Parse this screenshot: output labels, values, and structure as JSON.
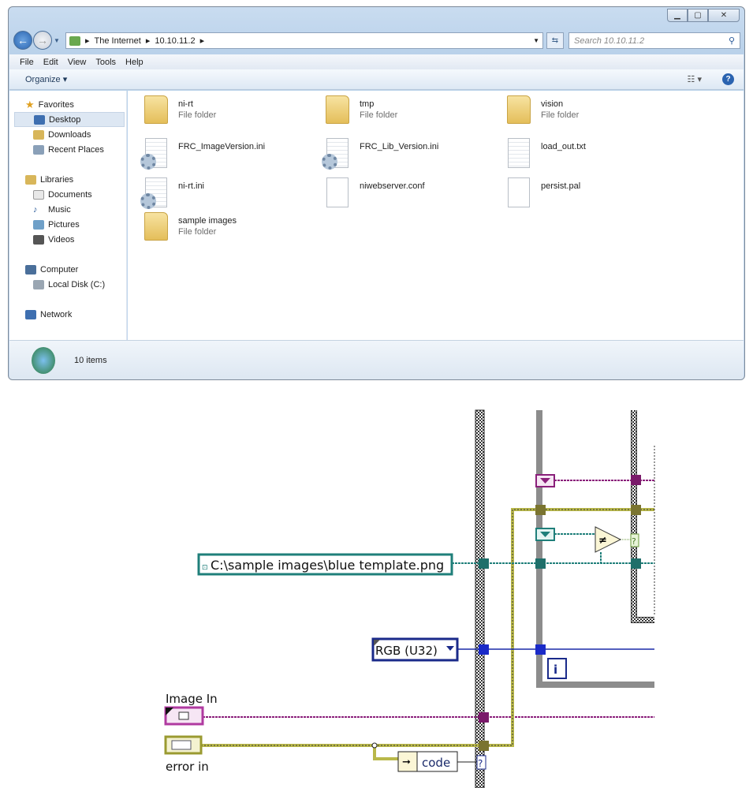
{
  "window": {
    "controls": [
      "minimize",
      "maximize",
      "close"
    ]
  },
  "address": {
    "segments": [
      "The Internet",
      "10.10.11.2"
    ],
    "search_placeholder": "Search 10.10.11.2"
  },
  "menu": [
    "File",
    "Edit",
    "View",
    "Tools",
    "Help"
  ],
  "toolbar": {
    "organize": "Organize ▾"
  },
  "sidebar": {
    "favorites": "Favorites",
    "desktop": "Desktop",
    "downloads": "Downloads",
    "recent": "Recent Places",
    "libraries": "Libraries",
    "documents": "Documents",
    "music": "Music",
    "pictures": "Pictures",
    "videos": "Videos",
    "computer": "Computer",
    "local_disk": "Local Disk (C:)",
    "network": "Network"
  },
  "files": [
    {
      "name": "ni-rt",
      "type": "File folder",
      "icon": "folder"
    },
    {
      "name": "tmp",
      "type": "File folder",
      "icon": "folder"
    },
    {
      "name": "vision",
      "type": "File folder",
      "icon": "folder"
    },
    {
      "name": "FRC_ImageVersion.ini",
      "type": "",
      "icon": "settings-file"
    },
    {
      "name": "FRC_Lib_Version.ini",
      "type": "",
      "icon": "settings-file"
    },
    {
      "name": "load_out.txt",
      "type": "",
      "icon": "text-file"
    },
    {
      "name": "ni-rt.ini",
      "type": "",
      "icon": "settings-file"
    },
    {
      "name": "niwebserver.conf",
      "type": "",
      "icon": "file"
    },
    {
      "name": "persist.pal",
      "type": "",
      "icon": "file"
    },
    {
      "name": "sample images",
      "type": "File folder",
      "icon": "folder"
    }
  ],
  "status": {
    "count": "10 items"
  },
  "diagram": {
    "path_constant": "C:\\sample images\\blue template.png",
    "image_type": "RGB (U32)",
    "image_in_label": "Image In",
    "error_in_label": "error in",
    "unbundle_field": "code",
    "iteration_terminal": "i",
    "not_equal": "≠",
    "unknown": "?",
    "colors": {
      "image_wire": "#8a1f7a",
      "path_wire": "#1f7f7a",
      "error_wire": "#b9b84a",
      "enum_wire": "#1a2aa8"
    }
  }
}
